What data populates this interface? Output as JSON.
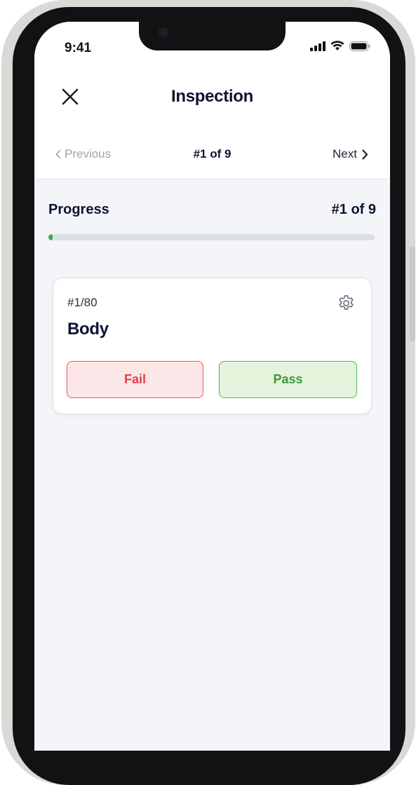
{
  "status_bar": {
    "time": "9:41"
  },
  "header": {
    "title": "Inspection",
    "close_icon": "close-icon"
  },
  "navigation": {
    "previous_label": "Previous",
    "counter": "#1 of 9",
    "next_label": "Next"
  },
  "progress": {
    "label": "Progress",
    "count": "#1 of 9",
    "fraction": 0.012,
    "fill_color": "#3ca84d"
  },
  "item": {
    "number": "#1/80",
    "name": "Body",
    "settings_icon": "gear-icon",
    "fail_label": "Fail",
    "pass_label": "Pass"
  },
  "colors": {
    "fail_text": "#e04048",
    "fail_bg": "#fde6e7",
    "pass_text": "#3a9b3c",
    "pass_bg": "#e6f3dc",
    "title": "#0f1331"
  }
}
